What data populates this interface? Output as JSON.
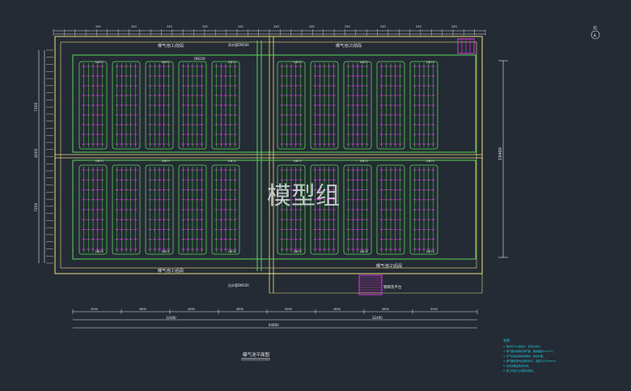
{
  "north_label": "北",
  "north_mark": "A",
  "watermark": "模型组",
  "drawing_title": "曝气池平面图",
  "zone_labels": {
    "upper_left": "曝气池(1)前段",
    "upper_right": "曝气池(2)前段",
    "lower_left": "曝气池(1)后段",
    "lower_right": "曝气池(2)后段"
  },
  "center_note_top": "进水管DN500",
  "center_note_bottom": "出水管DN500",
  "stair_label": "钢梯及平台",
  "upper_gallery_label": "DN250",
  "tank_labels": [
    "DN75",
    "DN75",
    "DN75",
    "DN75",
    "DN75",
    "DN75",
    "DN75",
    "DN75"
  ],
  "top_dims": [
    "240",
    "240",
    "240",
    "240",
    "240",
    "240",
    "240",
    "240",
    "240",
    "240",
    "240"
  ],
  "bottom_dims_row1": [
    "5000",
    "4800",
    "4800",
    "4800",
    "5000",
    "4800",
    "4800",
    "5000"
  ],
  "bottom_dims_row2": [
    "32400",
    "32400"
  ],
  "bottom_dims_total": "64800",
  "left_dims": [
    "7200",
    "4000",
    "7200"
  ],
  "right_dim": "19400",
  "notes_title": "说明",
  "notes": [
    "1. 图中尺寸以毫米计，标高以米计。",
    "2. 曝气器采用微孔曝气器，服务面积0.5m²/个。",
    "3. 空气管道采用焊接钢管，防腐处理。",
    "4. 曝气器安装时应保持水平，误差不大于±5mm。",
    "5. 支管末端设置排水阀。",
    "6. 施工时应与土建密切配合。"
  ],
  "colors": {
    "background": "#252b34",
    "wall": "#e8e07a",
    "pipe": "#57d957",
    "diffuser": "#e23ce2",
    "dimension": "#e6e6e6",
    "note": "#22d3e8",
    "stair": "#d93bd9"
  }
}
